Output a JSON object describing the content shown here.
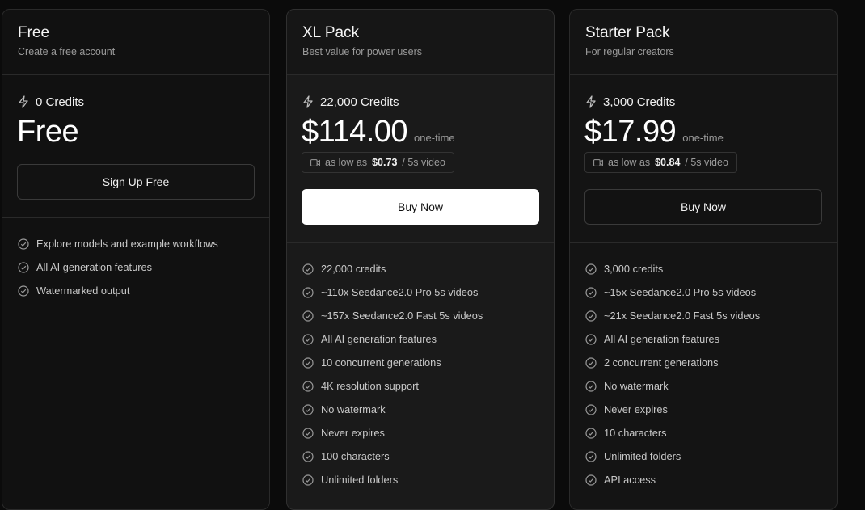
{
  "plans": [
    {
      "title": "Free",
      "subtitle": "Create a free account",
      "credits": "0 Credits",
      "price": "Free",
      "button_label": "Sign Up Free",
      "features": [
        "Explore models and example workflows",
        "All AI generation features",
        "Watermarked output"
      ]
    },
    {
      "title": "XL Pack",
      "subtitle": "Best value for power users",
      "credits": "22,000 Credits",
      "price": "$114.00",
      "price_note": "one-time",
      "per_video_prefix": "as low as",
      "per_video_price": "$0.73",
      "per_video_suffix": "/ 5s video",
      "button_label": "Buy Now",
      "features": [
        "22,000 credits",
        "~110x Seedance2.0 Pro 5s videos",
        "~157x Seedance2.0 Fast 5s videos",
        "All AI generation features",
        "10 concurrent generations",
        "4K resolution support",
        "No watermark",
        "Never expires",
        "100 characters",
        "Unlimited folders"
      ]
    },
    {
      "title": "Starter Pack",
      "subtitle": "For regular creators",
      "credits": "3,000 Credits",
      "price": "$17.99",
      "price_note": "one-time",
      "per_video_prefix": "as low as",
      "per_video_price": "$0.84",
      "per_video_suffix": "/ 5s video",
      "button_label": "Buy Now",
      "features": [
        "3,000 credits",
        "~15x Seedance2.0 Pro 5s videos",
        "~21x Seedance2.0 Fast 5s videos",
        "All AI generation features",
        "2 concurrent generations",
        "No watermark",
        "Never expires",
        "10 characters",
        "Unlimited folders",
        "API access"
      ]
    }
  ],
  "icons": {
    "credits": "lightning-bolt-icon",
    "per_video": "video-camera-icon",
    "feature": "check-circle-icon"
  },
  "colors": {
    "background": "#0b0b0b",
    "card": "#121212",
    "primary_button": "#ffffff"
  }
}
